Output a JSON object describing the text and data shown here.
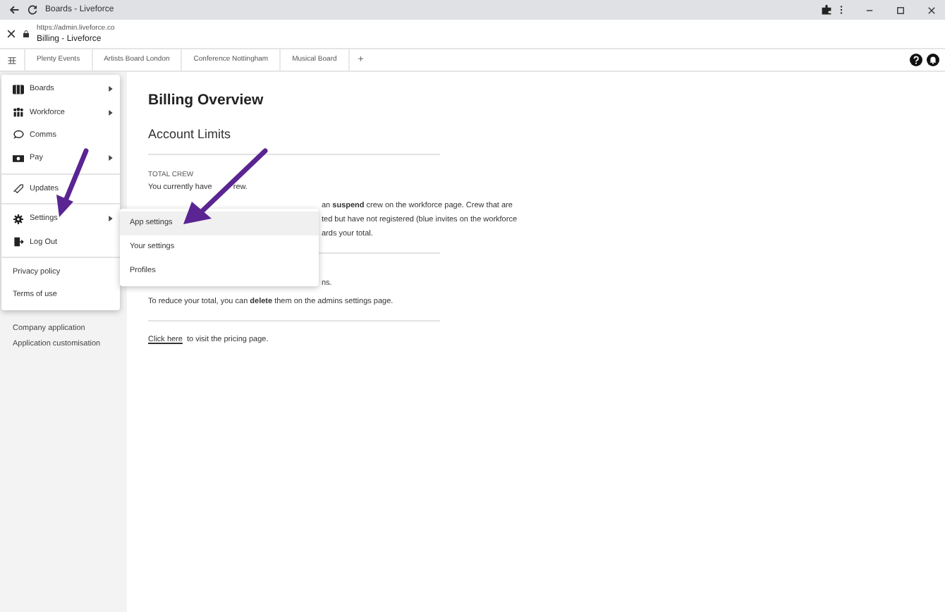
{
  "browser": {
    "title": "Boards - Liveforce",
    "url": "https://admin.liveforce.co",
    "page_title": "Billing - Liveforce"
  },
  "tabs": [
    {
      "label": "Plenty Events",
      "selected": false
    },
    {
      "label": "Artists Board London",
      "selected": false
    },
    {
      "label": "Conference Nottingham",
      "selected": false
    },
    {
      "label": "Musical Board",
      "selected": false
    }
  ],
  "add_tab": "+",
  "menu": {
    "sections": [
      [
        {
          "label": "Boards",
          "has_submenu": true
        },
        {
          "label": "Workforce",
          "has_submenu": true
        },
        {
          "label": "Comms",
          "has_submenu": false
        },
        {
          "label": "Pay",
          "has_submenu": true
        }
      ],
      [
        {
          "label": "Updates",
          "has_submenu": false
        }
      ],
      [
        {
          "label": "Settings",
          "has_submenu": true
        },
        {
          "label": "Log Out",
          "has_submenu": false
        }
      ],
      [
        {
          "label": "Privacy policy",
          "has_submenu": false
        },
        {
          "label": "Terms of use",
          "has_submenu": false
        }
      ]
    ]
  },
  "submenu": [
    {
      "label": "App settings",
      "selected": true
    },
    {
      "label": "Your settings",
      "selected": false
    },
    {
      "label": "Profiles",
      "selected": false
    }
  ],
  "sidebar": {
    "items": [
      "Company application",
      "Application customisation"
    ]
  },
  "main": {
    "title": "Billing Overview",
    "section": "Account Limits",
    "label": "TOTAL CREW",
    "crew_line": [
      "You currently have",
      "rew."
    ],
    "covered_lines": [
      "an **suspend** crew on the workforce page. Crew that are",
      "ted but have not registered (blue invites on the workforce",
      "ards your total."
    ],
    "covered_line_2": "ns.",
    "reduce_text": "To reduce your total, you can **delete** them on the admins settings page.",
    "link": "Click here",
    "link_text": "to visit the pricing page."
  }
}
